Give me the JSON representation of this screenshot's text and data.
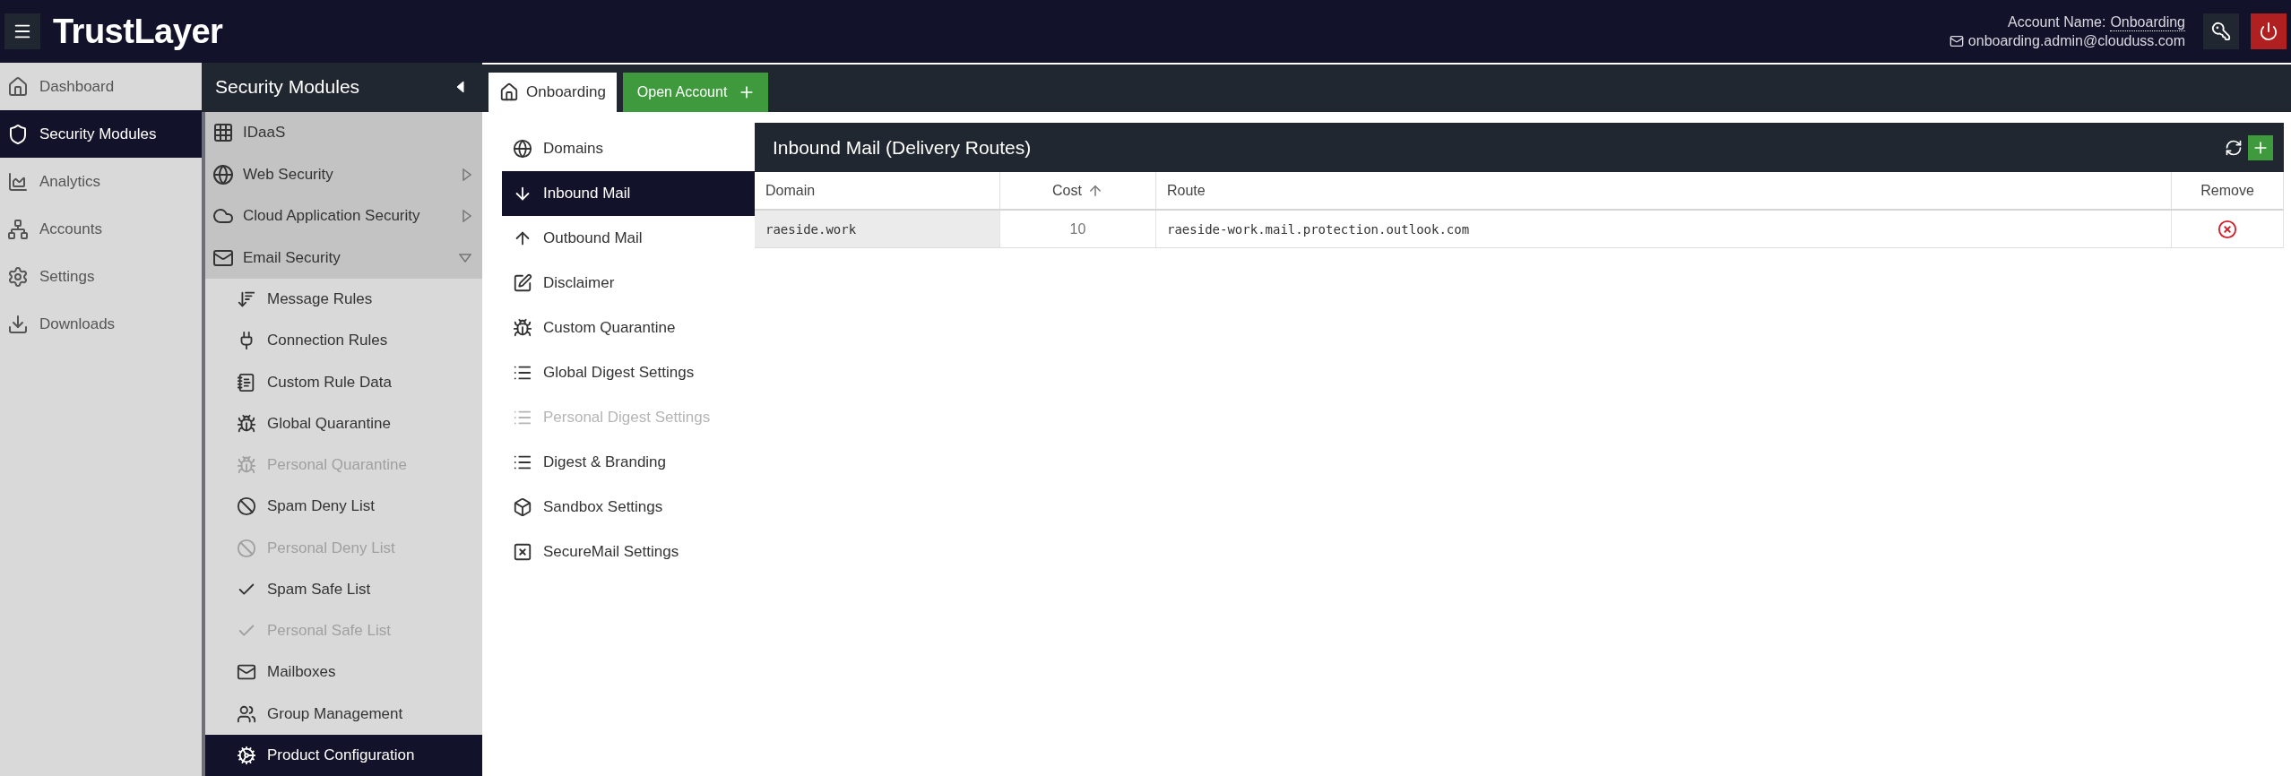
{
  "header": {
    "logo": "TrustLayer",
    "account_label": "Account Name:",
    "account_name": "Onboarding",
    "email": "onboarding.admin@clouduss.com"
  },
  "nav": [
    {
      "label": "Dashboard",
      "selected": false
    },
    {
      "label": "Security Modules",
      "selected": true
    },
    {
      "label": "Analytics",
      "selected": false
    },
    {
      "label": "Accounts",
      "selected": false
    },
    {
      "label": "Settings",
      "selected": false
    },
    {
      "label": "Downloads",
      "selected": false
    }
  ],
  "modules": {
    "title": "Security Modules",
    "items": [
      {
        "label": "IDaaS",
        "kind": "link"
      },
      {
        "label": "Web Security",
        "kind": "group",
        "expanded": false
      },
      {
        "label": "Cloud Application Security",
        "kind": "group",
        "expanded": false
      },
      {
        "label": "Email Security",
        "kind": "group",
        "expanded": true,
        "children": [
          {
            "label": "Message Rules",
            "disabled": false,
            "selected": false
          },
          {
            "label": "Connection Rules",
            "disabled": false,
            "selected": false
          },
          {
            "label": "Custom Rule Data",
            "disabled": false,
            "selected": false
          },
          {
            "label": "Global Quarantine",
            "disabled": false,
            "selected": false
          },
          {
            "label": "Personal Quarantine",
            "disabled": true,
            "selected": false
          },
          {
            "label": "Spam Deny List",
            "disabled": false,
            "selected": false
          },
          {
            "label": "Personal Deny List",
            "disabled": true,
            "selected": false
          },
          {
            "label": "Spam Safe List",
            "disabled": false,
            "selected": false
          },
          {
            "label": "Personal Safe List",
            "disabled": true,
            "selected": false
          },
          {
            "label": "Mailboxes",
            "disabled": false,
            "selected": false
          },
          {
            "label": "Group Management",
            "disabled": false,
            "selected": false
          },
          {
            "label": "Product Configuration",
            "disabled": false,
            "selected": true
          }
        ]
      }
    ]
  },
  "tabs": [
    {
      "label": "Onboarding",
      "selected": true
    }
  ],
  "open_account_button": "Open Account",
  "settings_menu": [
    {
      "label": "Domains",
      "selected": false,
      "disabled": false
    },
    {
      "label": "Inbound Mail",
      "selected": true,
      "disabled": false
    },
    {
      "label": "Outbound Mail",
      "selected": false,
      "disabled": false
    },
    {
      "label": "Disclaimer",
      "selected": false,
      "disabled": false
    },
    {
      "label": "Custom Quarantine",
      "selected": false,
      "disabled": false
    },
    {
      "label": "Global Digest Settings",
      "selected": false,
      "disabled": false
    },
    {
      "label": "Personal Digest Settings",
      "selected": false,
      "disabled": true
    },
    {
      "label": "Digest & Branding",
      "selected": false,
      "disabled": false
    },
    {
      "label": "Sandbox Settings",
      "selected": false,
      "disabled": false
    },
    {
      "label": "SecureMail Settings",
      "selected": false,
      "disabled": false
    }
  ],
  "panel": {
    "title": "Inbound Mail (Delivery Routes)",
    "columns": [
      {
        "label": "Domain",
        "sorted": false
      },
      {
        "label": "Cost",
        "sorted": true
      },
      {
        "label": "Route",
        "sorted": false
      },
      {
        "label": "Remove",
        "sorted": false
      }
    ],
    "rows": [
      {
        "domain": "raeside.work",
        "cost": "10",
        "route": "raeside-work.mail.protection.outlook.com"
      }
    ]
  }
}
